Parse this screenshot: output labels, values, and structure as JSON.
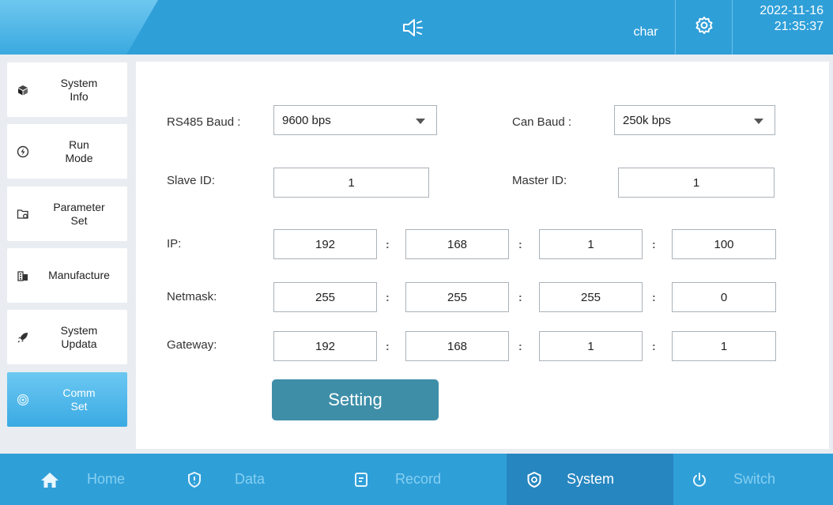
{
  "header": {
    "user": "char",
    "date": "2022-11-16",
    "time": "21:35:37"
  },
  "sidebar": {
    "items": [
      {
        "label": "System\nInfo",
        "icon": "cube-icon"
      },
      {
        "label": "Run\nMode",
        "icon": "lightning-circle-icon"
      },
      {
        "label": "Parameter\nSet",
        "icon": "folder-gear-icon"
      },
      {
        "label": "Manufacture",
        "icon": "building-icon"
      },
      {
        "label": "System\nUpdata",
        "icon": "rocket-icon"
      },
      {
        "label": "Comm\nSet",
        "icon": "signal-icon",
        "active": true
      }
    ]
  },
  "form": {
    "rs485_label": "RS485 Baud :",
    "rs485_value": "9600 bps",
    "can_label": "Can Baud :",
    "can_value": "250k bps",
    "slave_label": "Slave ID:",
    "slave_value": "1",
    "master_label": "Master ID:",
    "master_value": "1",
    "ip_label": "IP:",
    "ip": [
      "192",
      "168",
      "1",
      "100"
    ],
    "netmask_label": "Netmask:",
    "netmask": [
      "255",
      "255",
      "255",
      "0"
    ],
    "gateway_label": "Gateway:",
    "gateway": [
      "192",
      "168",
      "1",
      "1"
    ],
    "separator": ":",
    "setting_button": "Setting"
  },
  "bottom_nav": [
    {
      "label": "Home",
      "icon": "home-icon"
    },
    {
      "label": "Data",
      "icon": "shield-icon"
    },
    {
      "label": "Record",
      "icon": "document-icon"
    },
    {
      "label": "System",
      "icon": "system-gear-icon",
      "active": true
    },
    {
      "label": "Switch",
      "icon": "power-icon"
    }
  ],
  "colors": {
    "primary": "#2f9fd8",
    "active_nav": "#2686c0",
    "button": "#3e8ea8"
  }
}
